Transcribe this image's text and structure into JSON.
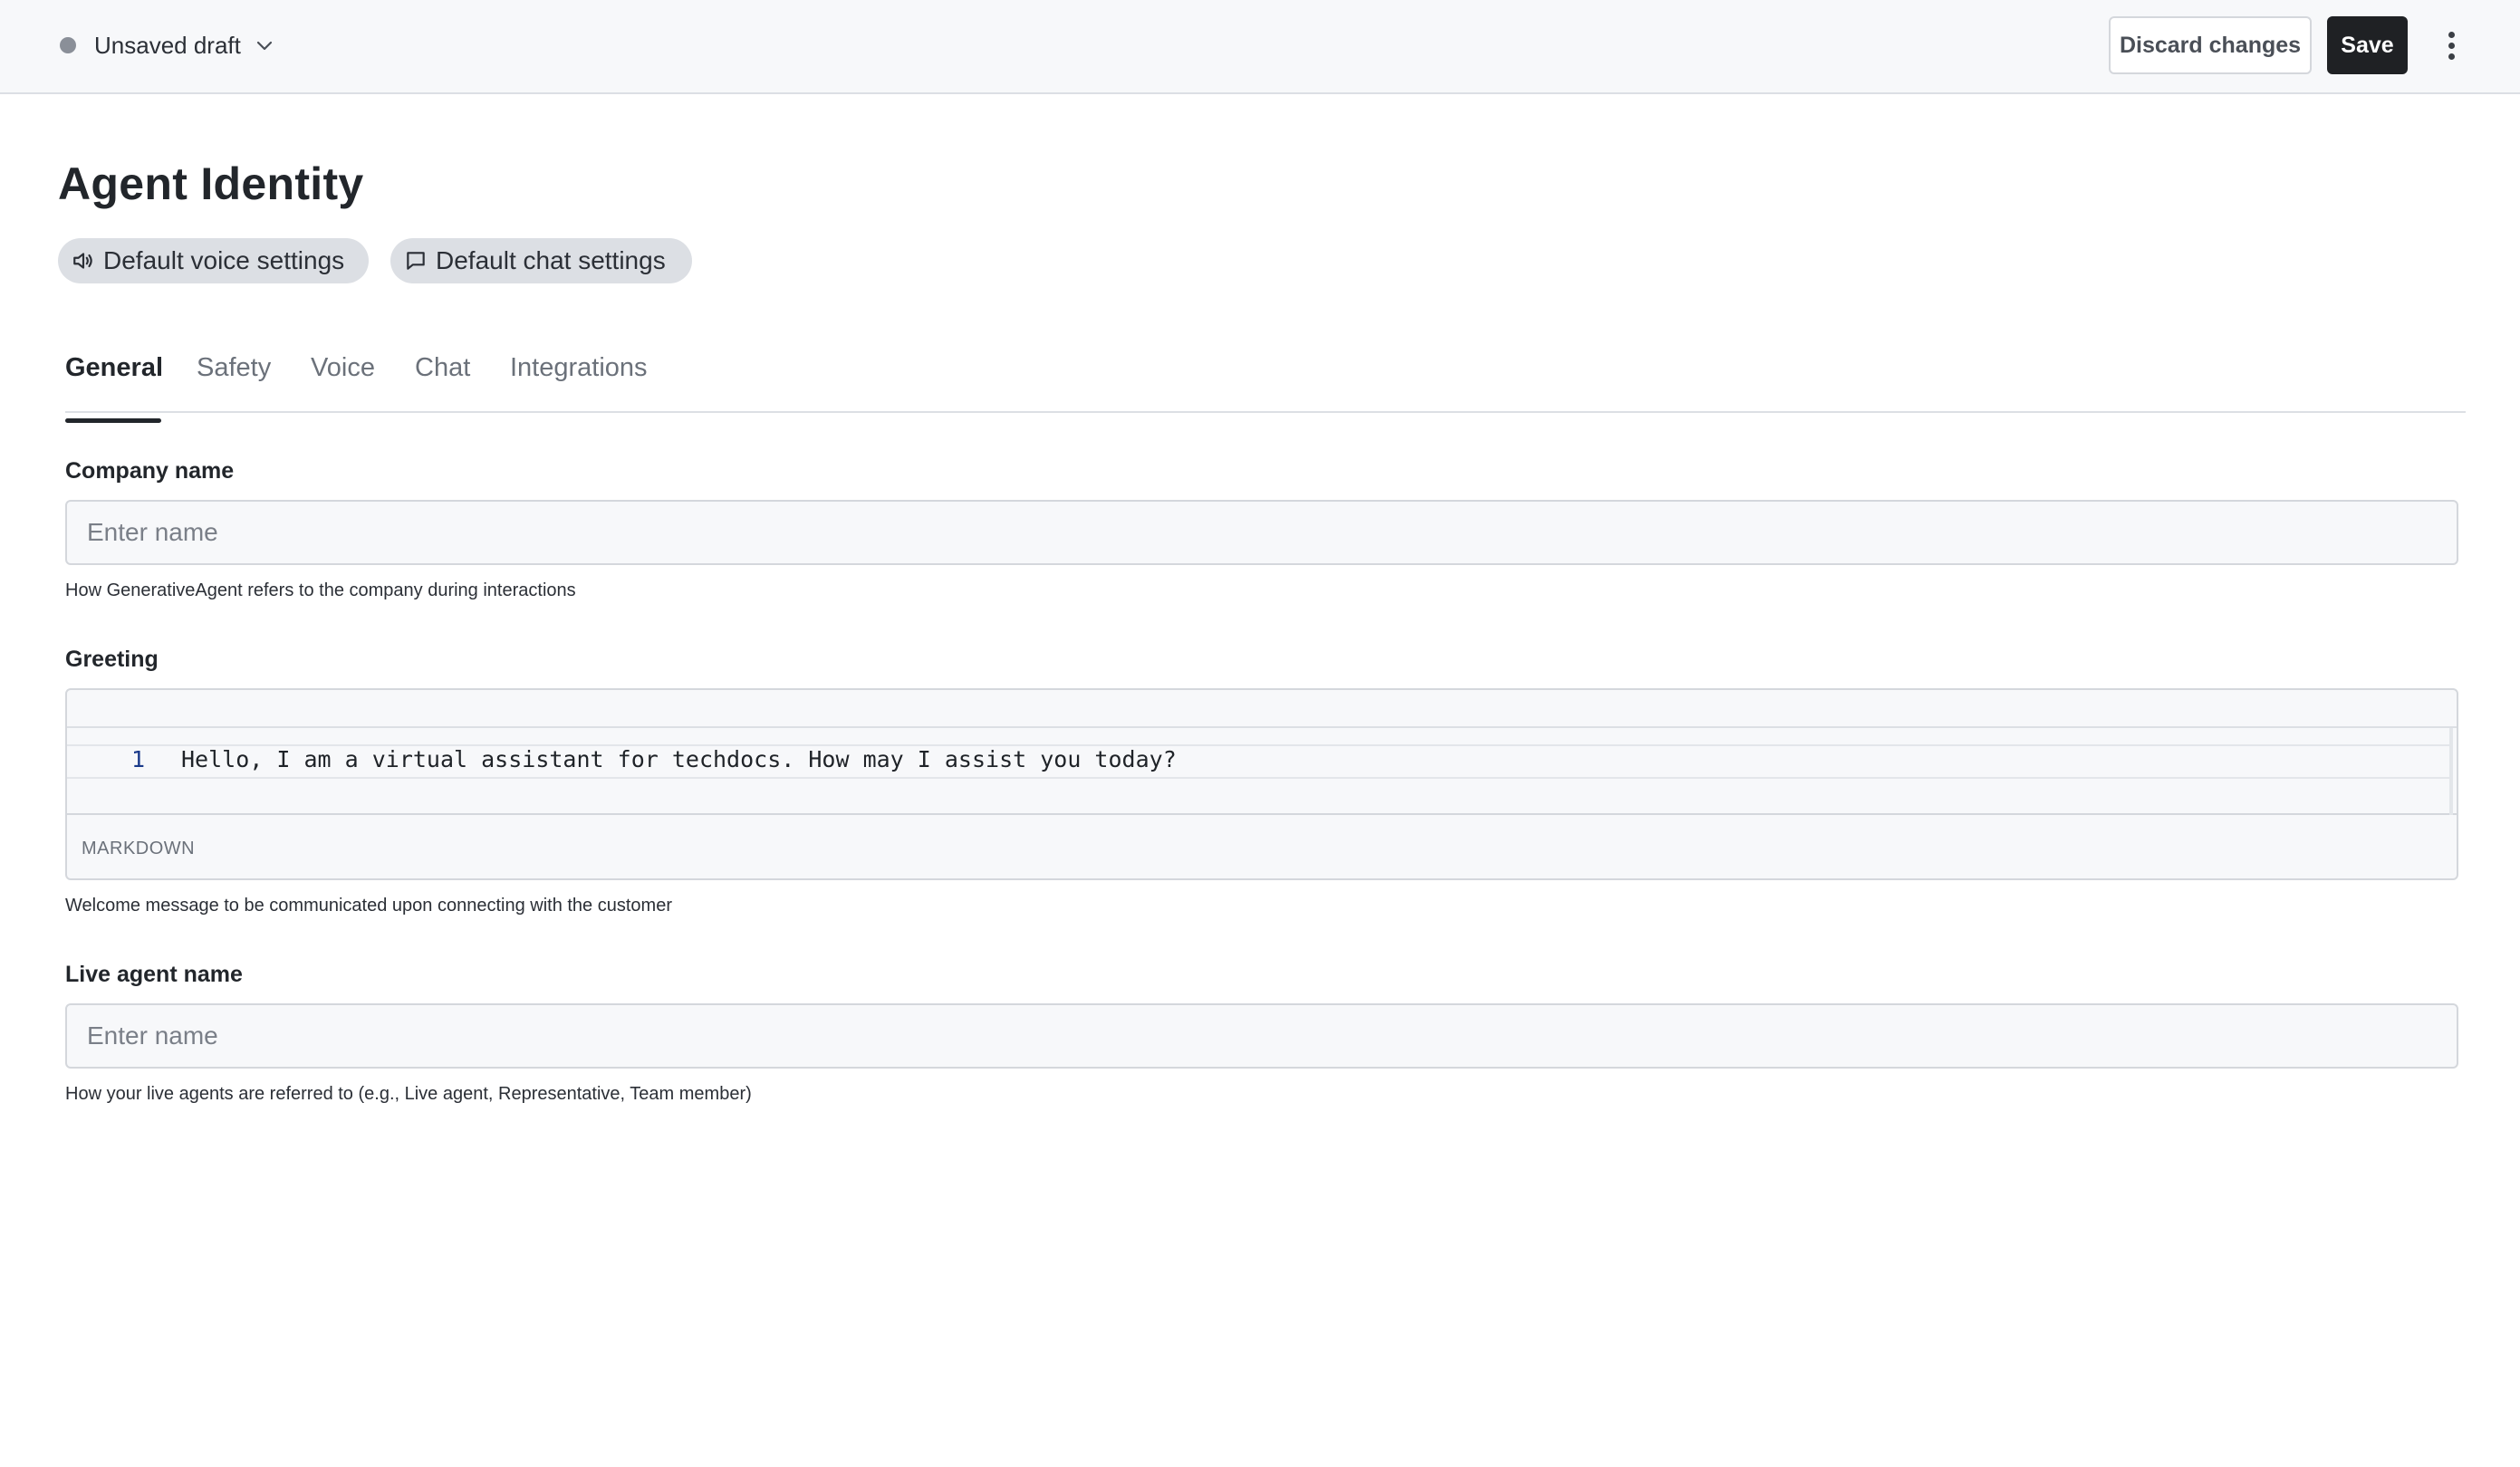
{
  "header": {
    "status_label": "Unsaved draft",
    "discard_label": "Discard changes",
    "save_label": "Save"
  },
  "page": {
    "title": "Agent Identity",
    "pills": [
      {
        "label": "Default voice settings",
        "icon": "speaker-icon"
      },
      {
        "label": "Default chat settings",
        "icon": "chat-bubble-icon"
      }
    ]
  },
  "tabs": [
    {
      "label": "General",
      "active": true
    },
    {
      "label": "Safety",
      "active": false
    },
    {
      "label": "Voice",
      "active": false
    },
    {
      "label": "Chat",
      "active": false
    },
    {
      "label": "Integrations",
      "active": false
    }
  ],
  "form": {
    "company_name": {
      "label": "Company name",
      "placeholder": "Enter name",
      "value": "",
      "helper": "How GenerativeAgent refers to the company during interactions"
    },
    "greeting": {
      "label": "Greeting",
      "line_number": "1",
      "value": "Hello, I am a virtual assistant for techdocs. How may I assist you today?",
      "mode": "MARKDOWN",
      "helper": "Welcome message to be communicated upon connecting with the customer"
    },
    "live_agent_name": {
      "label": "Live agent name",
      "placeholder": "Enter name",
      "value": "",
      "helper": "How your live agents are referred to (e.g., Live agent, Representative, Team member)"
    }
  }
}
